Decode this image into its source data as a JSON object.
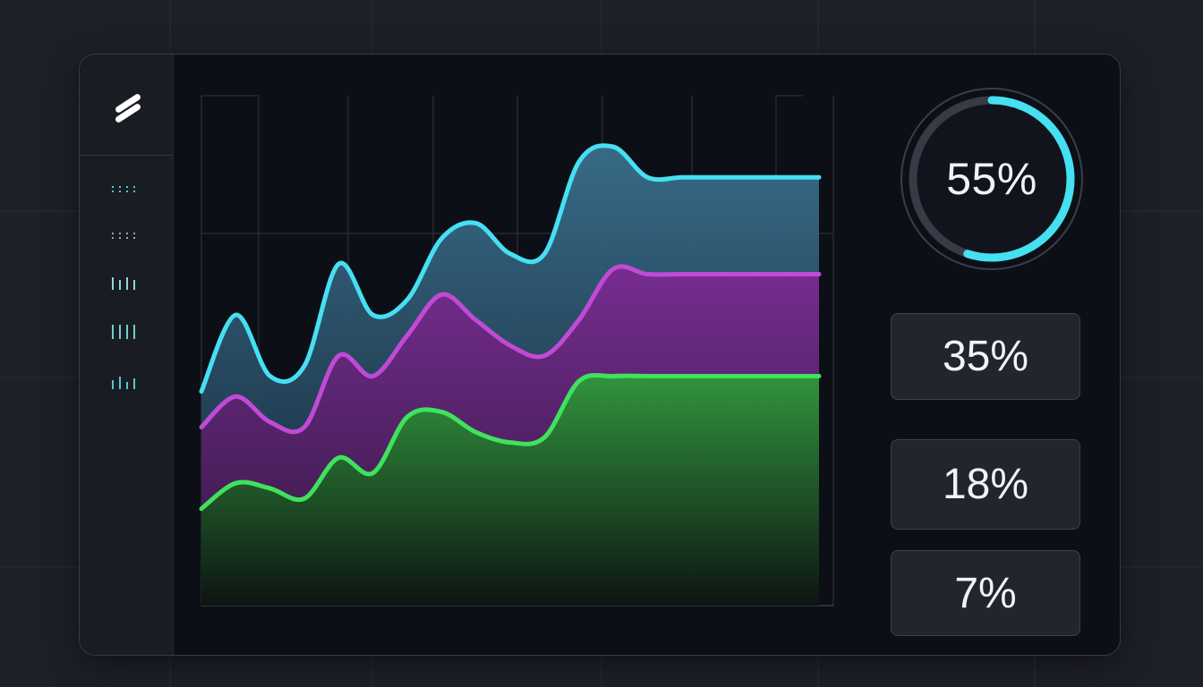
{
  "colors": {
    "page_bg": "#1e2028",
    "card_bg": "#0d0f17",
    "sidebar_bg": "#1a1c24",
    "cyan": "#45e0f2",
    "magenta": "#c04ad6",
    "green": "#3fe25c",
    "nav_dots": "#56c8c8",
    "text": "#f1f3f6"
  },
  "sidebar": {
    "logo": "slash-logo-icon",
    "items": [
      {
        "icon": "dots-grid-icon"
      },
      {
        "icon": "dots-grid-icon"
      },
      {
        "icon": "bars-icon"
      },
      {
        "icon": "bars-icon"
      },
      {
        "icon": "equalizer-icon"
      }
    ]
  },
  "chart_data": {
    "type": "area",
    "title": "",
    "xlabel": "",
    "ylabel": "",
    "x": [
      0,
      0.5,
      1,
      1.5,
      2,
      2.5,
      3,
      3.5,
      4,
      4.5,
      5,
      5.5,
      6,
      6.5,
      7,
      7.5,
      8,
      8.5,
      9
    ],
    "xlim": [
      0,
      9
    ],
    "ylim": [
      0,
      100
    ],
    "grid": true,
    "legend": "none",
    "series": [
      {
        "color": "#45e0f2",
        "values": [
          42,
          57,
          45,
          47,
          67,
          57,
          60,
          72,
          75,
          69,
          69,
          87,
          90,
          84,
          84,
          84,
          84,
          84,
          84
        ]
      },
      {
        "color": "#c04ad6",
        "values": [
          35,
          41,
          36,
          35,
          49,
          45,
          53,
          61,
          56,
          51,
          49,
          56,
          66,
          65,
          65,
          65,
          65,
          65,
          65
        ]
      },
      {
        "color": "#3fe25c",
        "values": [
          19,
          24,
          23,
          21,
          29,
          26,
          37,
          38,
          34,
          32,
          33,
          44,
          45,
          45,
          45,
          45,
          45,
          45,
          45
        ]
      }
    ]
  },
  "gauge": {
    "label": "55%",
    "value": 55
  },
  "stats": [
    {
      "label": "35%"
    },
    {
      "label": "18%"
    },
    {
      "label": "7%"
    }
  ]
}
